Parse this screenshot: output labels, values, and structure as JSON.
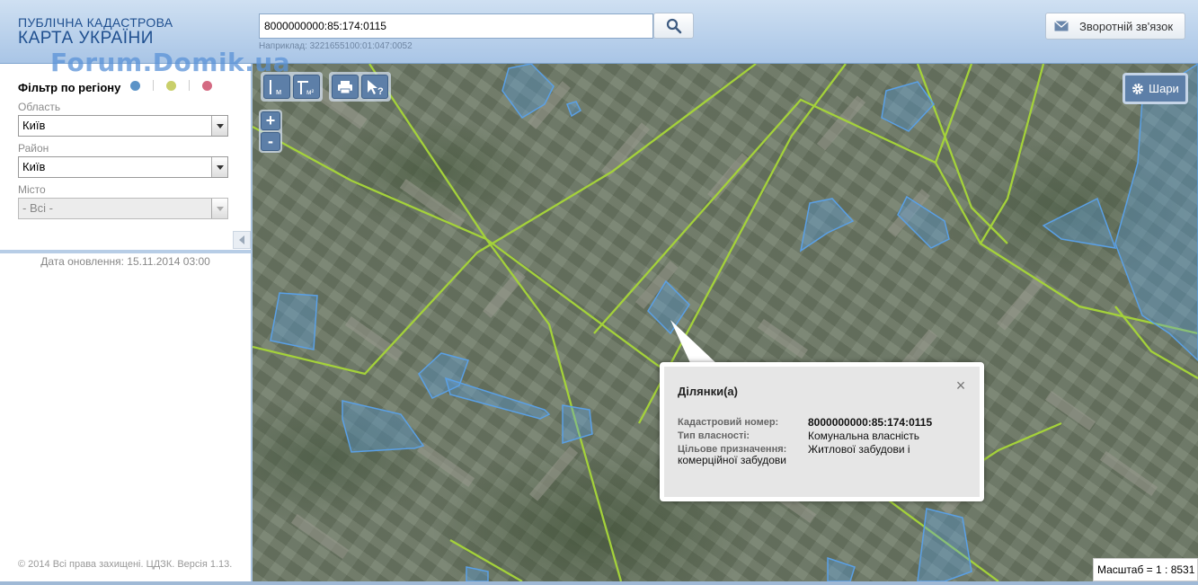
{
  "header": {
    "logo_line1": "ПУБЛІЧНА КАДАСТРОВА",
    "logo_line2": "КАРТА УКРАЇНИ",
    "watermark": "Forum.Domik.ua",
    "search_value": "8000000000:85:174:0115",
    "search_hint": "Наприклад: 3221655100:01:047:0052",
    "search_icon": "search-icon",
    "feedback_label": "Зворотній зв'язок",
    "feedback_icon": "envelope-icon"
  },
  "sidebar": {
    "filter_title": "Фільтр по регіону",
    "region_dot_colors": [
      "#5b93c7",
      "#c9cf6a",
      "#d46a82"
    ],
    "oblast_label": "Область",
    "oblast_value": "Київ",
    "raion_label": "Район",
    "raion_value": "Київ",
    "city_label": "Місто",
    "city_value": "- Всі -",
    "update_date": "Дата оновлення: 15.11.2014 03:00",
    "copyright": "© 2014 Всі права захищені. ЦДЗК. Версія 1.13."
  },
  "map": {
    "tools": {
      "measure_length_sub": "м",
      "measure_area_sub": "м²"
    },
    "zoom_in": "+",
    "zoom_out": "-",
    "layers_label": "Шари",
    "layers_icon": "gear-icon",
    "scale_text": "Масштаб = 1 : 8531",
    "road_color": "#a4d23a",
    "parcel_color": "#5aa0e6"
  },
  "popup": {
    "title": "Ділянки(а)",
    "close": "×",
    "cadastral_label": "Кадастровий номер:",
    "cadastral_value": "8000000000:85:174:0115",
    "ownership_label": "Тип власності:",
    "ownership_value": "Комунальна власність",
    "purpose_label": "Цільове призначення:",
    "purpose_value": "Житлової забудови і",
    "purpose_value_cont": "комерційної забудови"
  }
}
